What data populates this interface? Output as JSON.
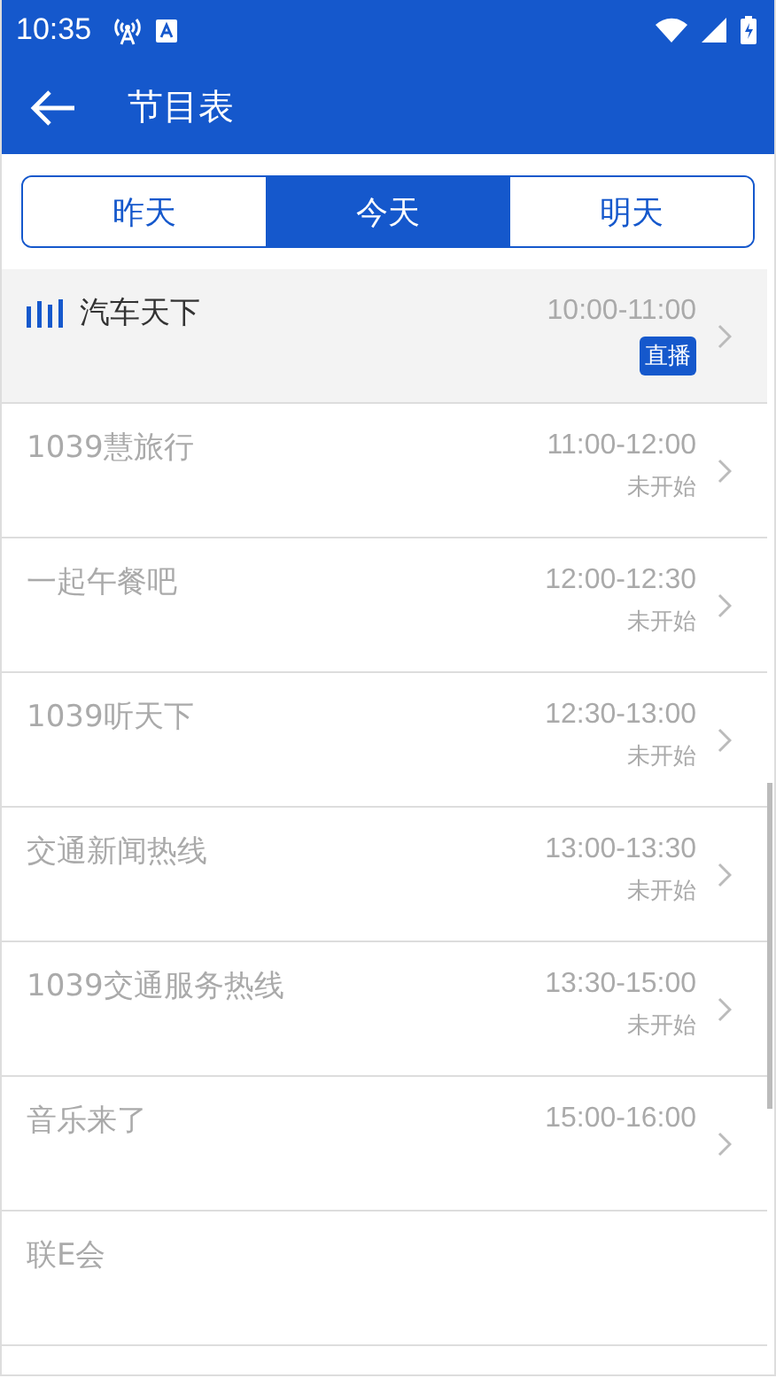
{
  "status_bar": {
    "time": "10:35"
  },
  "app_bar": {
    "title": "节目表"
  },
  "tabs": [
    {
      "label": "昨天",
      "selected": false
    },
    {
      "label": "今天",
      "selected": true
    },
    {
      "label": "明天",
      "selected": false
    }
  ],
  "programs": [
    {
      "name": "汽车天下",
      "time": "10:00-11:00",
      "status": "直播",
      "live": true
    },
    {
      "name": "1039慧旅行",
      "time": "11:00-12:00",
      "status": "未开始",
      "live": false
    },
    {
      "name": "一起午餐吧",
      "time": "12:00-12:30",
      "status": "未开始",
      "live": false
    },
    {
      "name": "1039听天下",
      "time": "12:30-13:00",
      "status": "未开始",
      "live": false
    },
    {
      "name": "交通新闻热线",
      "time": "13:00-13:30",
      "status": "未开始",
      "live": false
    },
    {
      "name": "1039交通服务热线",
      "time": "13:30-15:00",
      "status": "未开始",
      "live": false
    },
    {
      "name": "音乐来了",
      "time": "15:00-16:00",
      "live": false
    },
    {
      "name": "联E会",
      "live": false
    }
  ]
}
